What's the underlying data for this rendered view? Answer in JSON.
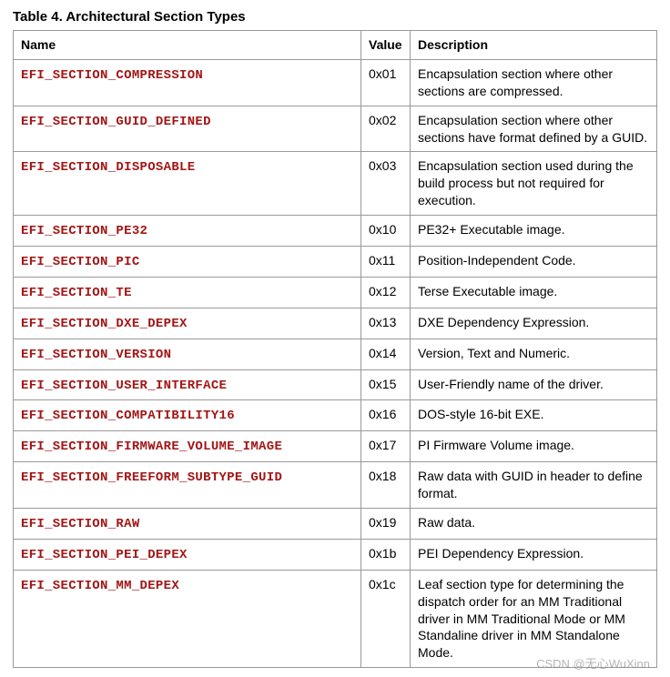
{
  "title": "Table 4. Architectural Section Types",
  "headers": {
    "name": "Name",
    "value": "Value",
    "description": "Description"
  },
  "rows": [
    {
      "name": "EFI_SECTION_COMPRESSION",
      "value": "0x01",
      "description": "Encapsulation section where other sections are compressed."
    },
    {
      "name": "EFI_SECTION_GUID_DEFINED",
      "value": "0x02",
      "description": "Encapsulation section where other sections have format defined by a GUID."
    },
    {
      "name": "EFI_SECTION_DISPOSABLE",
      "value": "0x03",
      "description": "Encapsulation section used during the build process but not required for execution."
    },
    {
      "name": "EFI_SECTION_PE32",
      "value": "0x10",
      "description": "PE32+ Executable image."
    },
    {
      "name": "EFI_SECTION_PIC",
      "value": "0x11",
      "description": "Position-Independent Code."
    },
    {
      "name": "EFI_SECTION_TE",
      "value": "0x12",
      "description": "Terse Executable image."
    },
    {
      "name": "EFI_SECTION_DXE_DEPEX",
      "value": "0x13",
      "description": "DXE Dependency Expression."
    },
    {
      "name": "EFI_SECTION_VERSION",
      "value": "0x14",
      "description": "Version, Text and Numeric."
    },
    {
      "name": "EFI_SECTION_USER_INTERFACE",
      "value": "0x15",
      "description": "User-Friendly name of the driver."
    },
    {
      "name": "EFI_SECTION_COMPATIBILITY16",
      "value": "0x16",
      "description": "DOS-style 16-bit EXE."
    },
    {
      "name": "EFI_SECTION_FIRMWARE_VOLUME_IMAGE",
      "value": "0x17",
      "description": "PI Firmware Volume image."
    },
    {
      "name": "EFI_SECTION_FREEFORM_SUBTYPE_GUID",
      "value": "0x18",
      "description": "Raw data with GUID in header to define format."
    },
    {
      "name": "EFI_SECTION_RAW",
      "value": "0x19",
      "description": "Raw data."
    },
    {
      "name": "EFI_SECTION_PEI_DEPEX",
      "value": "0x1b",
      "description": "PEI Dependency Expression."
    },
    {
      "name": "EFI_SECTION_MM_DEPEX",
      "value": "0x1c",
      "description": "Leaf section type for determining the dispatch order for an MM Traditional driver in MM Traditional Mode or MM Standaline driver in MM Standalone Mode."
    }
  ],
  "watermark": "CSDN @无心WuXinn"
}
